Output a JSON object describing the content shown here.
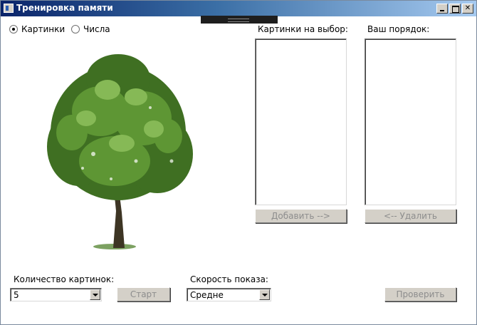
{
  "window": {
    "title": "Тренировка памяти"
  },
  "mode": {
    "options": [
      {
        "label": "Картинки",
        "checked": true
      },
      {
        "label": "Числа",
        "checked": false
      }
    ]
  },
  "image": {
    "subject": "tree"
  },
  "available": {
    "label": "Картинки на выбор:",
    "add_button": "Добавить -->"
  },
  "order": {
    "label": "Ваш порядок:",
    "remove_button": "<-- Удалить"
  },
  "count": {
    "label": "Количество картинок:",
    "value": "5"
  },
  "start_button": "Старт",
  "speed": {
    "label": "Скорость показа:",
    "value": "Средне"
  },
  "check_button": "Проверить",
  "colors": {
    "titlebar_start": "#0a246a",
    "titlebar_end": "#a6caf0",
    "face": "#d4d0c8",
    "disabled_text": "#8d8d8d"
  }
}
